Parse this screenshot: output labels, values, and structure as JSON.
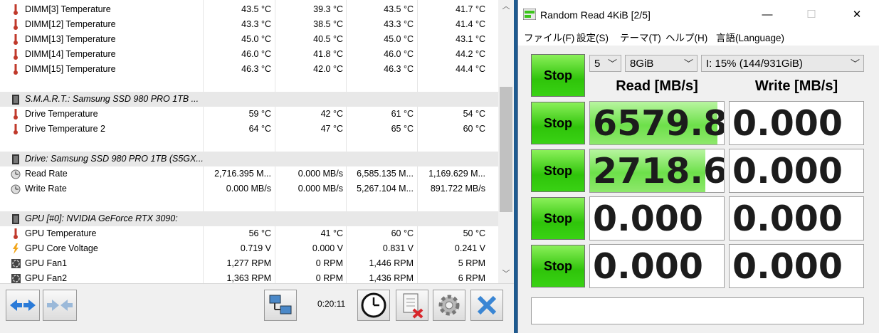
{
  "hwinfo": {
    "rows": [
      {
        "type": "sensor",
        "icon": "thermometer-icon",
        "name": "DIMM[3] Temperature",
        "values": [
          "43.5 °C",
          "39.3 °C",
          "43.5 °C",
          "41.7 °C"
        ]
      },
      {
        "type": "sensor",
        "icon": "thermometer-icon",
        "name": "DIMM[12] Temperature",
        "values": [
          "43.3 °C",
          "38.5 °C",
          "43.3 °C",
          "41.4 °C"
        ]
      },
      {
        "type": "sensor",
        "icon": "thermometer-icon",
        "name": "DIMM[13] Temperature",
        "values": [
          "45.0 °C",
          "40.5 °C",
          "45.0 °C",
          "43.1 °C"
        ]
      },
      {
        "type": "sensor",
        "icon": "thermometer-icon",
        "name": "DIMM[14] Temperature",
        "values": [
          "46.0 °C",
          "41.8 °C",
          "46.0 °C",
          "44.2 °C"
        ]
      },
      {
        "type": "sensor",
        "icon": "thermometer-icon",
        "name": "DIMM[15] Temperature",
        "values": [
          "46.3 °C",
          "42.0 °C",
          "46.3 °C",
          "44.4 °C"
        ]
      },
      {
        "type": "blank"
      },
      {
        "type": "section",
        "icon": "chip-icon",
        "name": "S.M.A.R.T.: Samsung SSD 980 PRO 1TB ..."
      },
      {
        "type": "sensor",
        "icon": "thermometer-icon",
        "name": "Drive Temperature",
        "values": [
          "59 °C",
          "42 °C",
          "61 °C",
          "54 °C"
        ]
      },
      {
        "type": "sensor",
        "icon": "thermometer-icon",
        "name": "Drive Temperature 2",
        "values": [
          "64 °C",
          "47 °C",
          "65 °C",
          "60 °C"
        ]
      },
      {
        "type": "blank"
      },
      {
        "type": "section",
        "icon": "chip-icon",
        "name": "Drive: Samsung SSD 980 PRO 1TB (S5GX..."
      },
      {
        "type": "sensor",
        "icon": "clock-icon",
        "name": "Read Rate",
        "values": [
          "2,716.395 M...",
          "0.000 MB/s",
          "6,585.135 M...",
          "1,169.629 M..."
        ]
      },
      {
        "type": "sensor",
        "icon": "clock-icon",
        "name": "Write Rate",
        "values": [
          "0.000 MB/s",
          "0.000 MB/s",
          "5,267.104 M...",
          "891.722 MB/s"
        ]
      },
      {
        "type": "blank"
      },
      {
        "type": "section",
        "icon": "chip-icon",
        "name": "GPU [#0]: NVIDIA GeForce RTX 3090:"
      },
      {
        "type": "sensor",
        "icon": "thermometer-icon",
        "name": "GPU Temperature",
        "values": [
          "56 °C",
          "41 °C",
          "60 °C",
          "50 °C"
        ]
      },
      {
        "type": "sensor",
        "icon": "lightning-icon",
        "name": "GPU Core Voltage",
        "values": [
          "0.719 V",
          "0.000 V",
          "0.831 V",
          "0.241 V"
        ]
      },
      {
        "type": "sensor",
        "icon": "fan-icon",
        "name": "GPU Fan1",
        "values": [
          "1,277 RPM",
          "0 RPM",
          "1,446 RPM",
          "5 RPM"
        ]
      },
      {
        "type": "sensor",
        "icon": "fan-icon",
        "name": "GPU Fan2",
        "values": [
          "1,363 RPM",
          "0 RPM",
          "1,436 RPM",
          "6 RPM"
        ]
      }
    ],
    "toolbar": {
      "timer": "0:20:11"
    },
    "colors": {
      "section_bg": "#e8e8e8",
      "thermometer": "#c0392b"
    }
  },
  "cdm": {
    "title": "Random Read 4KiB [2/5]",
    "window_buttons": {
      "minimize": "—",
      "maximize": "☐",
      "close": "✕"
    },
    "menu": [
      "ファイル(F)",
      "設定(S)",
      "テーマ(T)",
      "ヘルプ(H)",
      "言語(Language)"
    ],
    "selectors": {
      "count": "5",
      "size": "8GiB",
      "drive": "I: 15% (144/931GiB)"
    },
    "headers": {
      "read": "Read [MB/s]",
      "write": "Write [MB/s]"
    },
    "buttons": {
      "all": "Stop",
      "row1": "Stop",
      "row2": "Stop",
      "row3": "Stop",
      "row4": "Stop"
    },
    "results": [
      {
        "read": "6579.8",
        "write": "0.000",
        "read_fill": 0.95,
        "write_fill": 0
      },
      {
        "read": "2718.6",
        "write": "0.000",
        "read_fill": 0.86,
        "write_fill": 0
      },
      {
        "read": "0.000",
        "write": "0.000",
        "read_fill": 0,
        "write_fill": 0
      },
      {
        "read": "0.000",
        "write": "0.000",
        "read_fill": 0,
        "write_fill": 0
      }
    ],
    "colors": {
      "stop_green": "#2fc40a",
      "bar_green": "#6de04a"
    }
  }
}
